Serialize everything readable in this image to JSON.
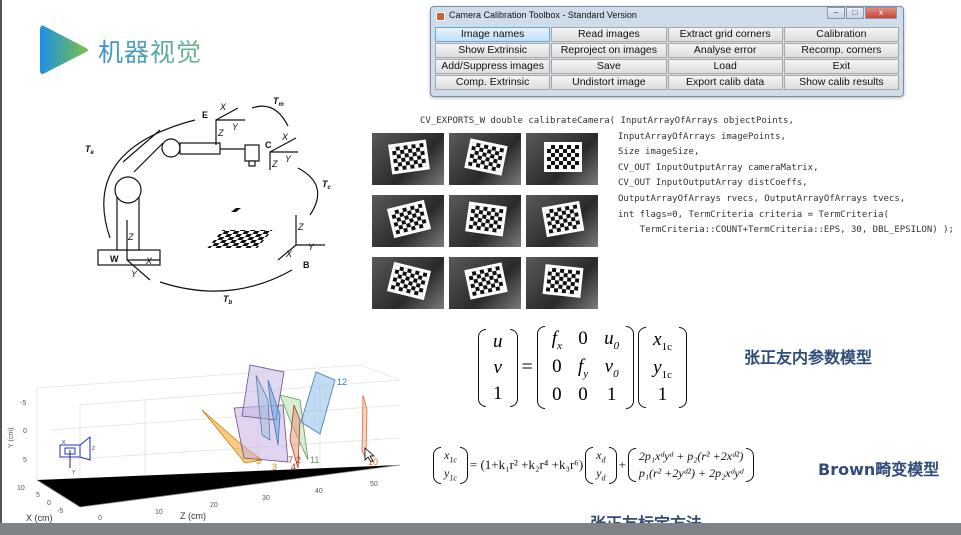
{
  "logo": {
    "text": "机器视觉",
    "colors": [
      "#1e90e8",
      "#7cc242"
    ]
  },
  "toolbox": {
    "title": "Camera Calibration Toolbox - Standard Version",
    "window_controls": [
      "minimize",
      "maximize",
      "close"
    ],
    "buttons": [
      "Image names",
      "Read images",
      "Extract grid corners",
      "Calibration",
      "Show Extrinsic",
      "Reproject on images",
      "Analyse error",
      "Recomp. corners",
      "Add/Suppress images",
      "Save",
      "Load",
      "Exit",
      "Comp. Extrinsic",
      "Undistort image",
      "Export calib data",
      "Show calib results"
    ],
    "active_button": "Image names"
  },
  "code": {
    "lines": [
      "CV_EXPORTS_W double calibrateCamera( InputArrayOfArrays objectPoints,",
      "InputArrayOfArrays imagePoints,",
      "Size imageSize,",
      "CV_OUT InputOutputArray cameraMatrix,",
      "CV_OUT InputOutputArray distCoeffs,",
      "OutputArrayOfArrays rvecs, OutputArrayOfArrays tvecs,",
      "int flags=0, TermCriteria criteria = TermCriteria(",
      "    TermCriteria::COUNT+TermCriteria::EPS, 30, DBL_EPSILON) );"
    ]
  },
  "diagram": {
    "frames": {
      "E": "E",
      "C": "C",
      "W": "W",
      "B": "B"
    },
    "axes": {
      "xe": "X",
      "ye": "Y",
      "ze": "Z",
      "xc": "X",
      "yc": "Y",
      "zc": "Z",
      "zb": "Z",
      "yb": "Y",
      "xb": "X",
      "zw": "Z",
      "yw": "Y",
      "xw": "X"
    },
    "subs": {
      "e": "e",
      "c": "c",
      "b": "b",
      "w": "W"
    },
    "transforms": {
      "t1": "T",
      "t1s": "e",
      "t2": "T",
      "t2s": "m",
      "t3": "T",
      "t3s": "c",
      "t4": "T",
      "t4s": "b"
    }
  },
  "plot3d": {
    "ylabel": "Y (cm)",
    "xlabel": "X (cm)",
    "zlabel": "Z (cm)",
    "yticks": [
      "-5",
      "0",
      "5"
    ],
    "xticks": [
      "10",
      "5",
      "0",
      "-5"
    ],
    "zticks": [
      "0",
      "10",
      "20",
      "30",
      "40",
      "50"
    ],
    "plane_labels": [
      "12",
      "5",
      "3",
      "7",
      "2",
      "4",
      "11",
      "10"
    ],
    "camera_axes": [
      "X",
      "Z",
      "Y"
    ]
  },
  "intrinsic": {
    "lhs": [
      "u",
      "v",
      "1"
    ],
    "K": [
      [
        "f",
        "0",
        "u"
      ],
      [
        "0",
        "f",
        "v"
      ],
      [
        "0",
        "0",
        "1"
      ]
    ],
    "K_subs": [
      [
        "x",
        "",
        "0"
      ],
      [
        "",
        "y",
        "0"
      ],
      [
        "",
        "",
        ""
      ]
    ],
    "rhs": [
      "x",
      "y",
      "1"
    ],
    "rhs_sub": "1c",
    "label": "张正友内参数模型"
  },
  "distortion": {
    "lhs": [
      "x",
      "y"
    ],
    "lhs_sub": "1c",
    "radial": "= (1+k₁r² +k₂r⁴ +k₃r⁶)",
    "vec": [
      "x",
      "y"
    ],
    "vec_sub": "d",
    "plus": "+",
    "tangential": [
      "2p₁xᵈyᵈ + p₂(r² +2xᵈ²)",
      "p₁(r² +2yᵈ²) + 2p₂xᵈyᵈ"
    ],
    "label": "Brown畸变模型"
  },
  "footer_title": "张正友标定方法"
}
